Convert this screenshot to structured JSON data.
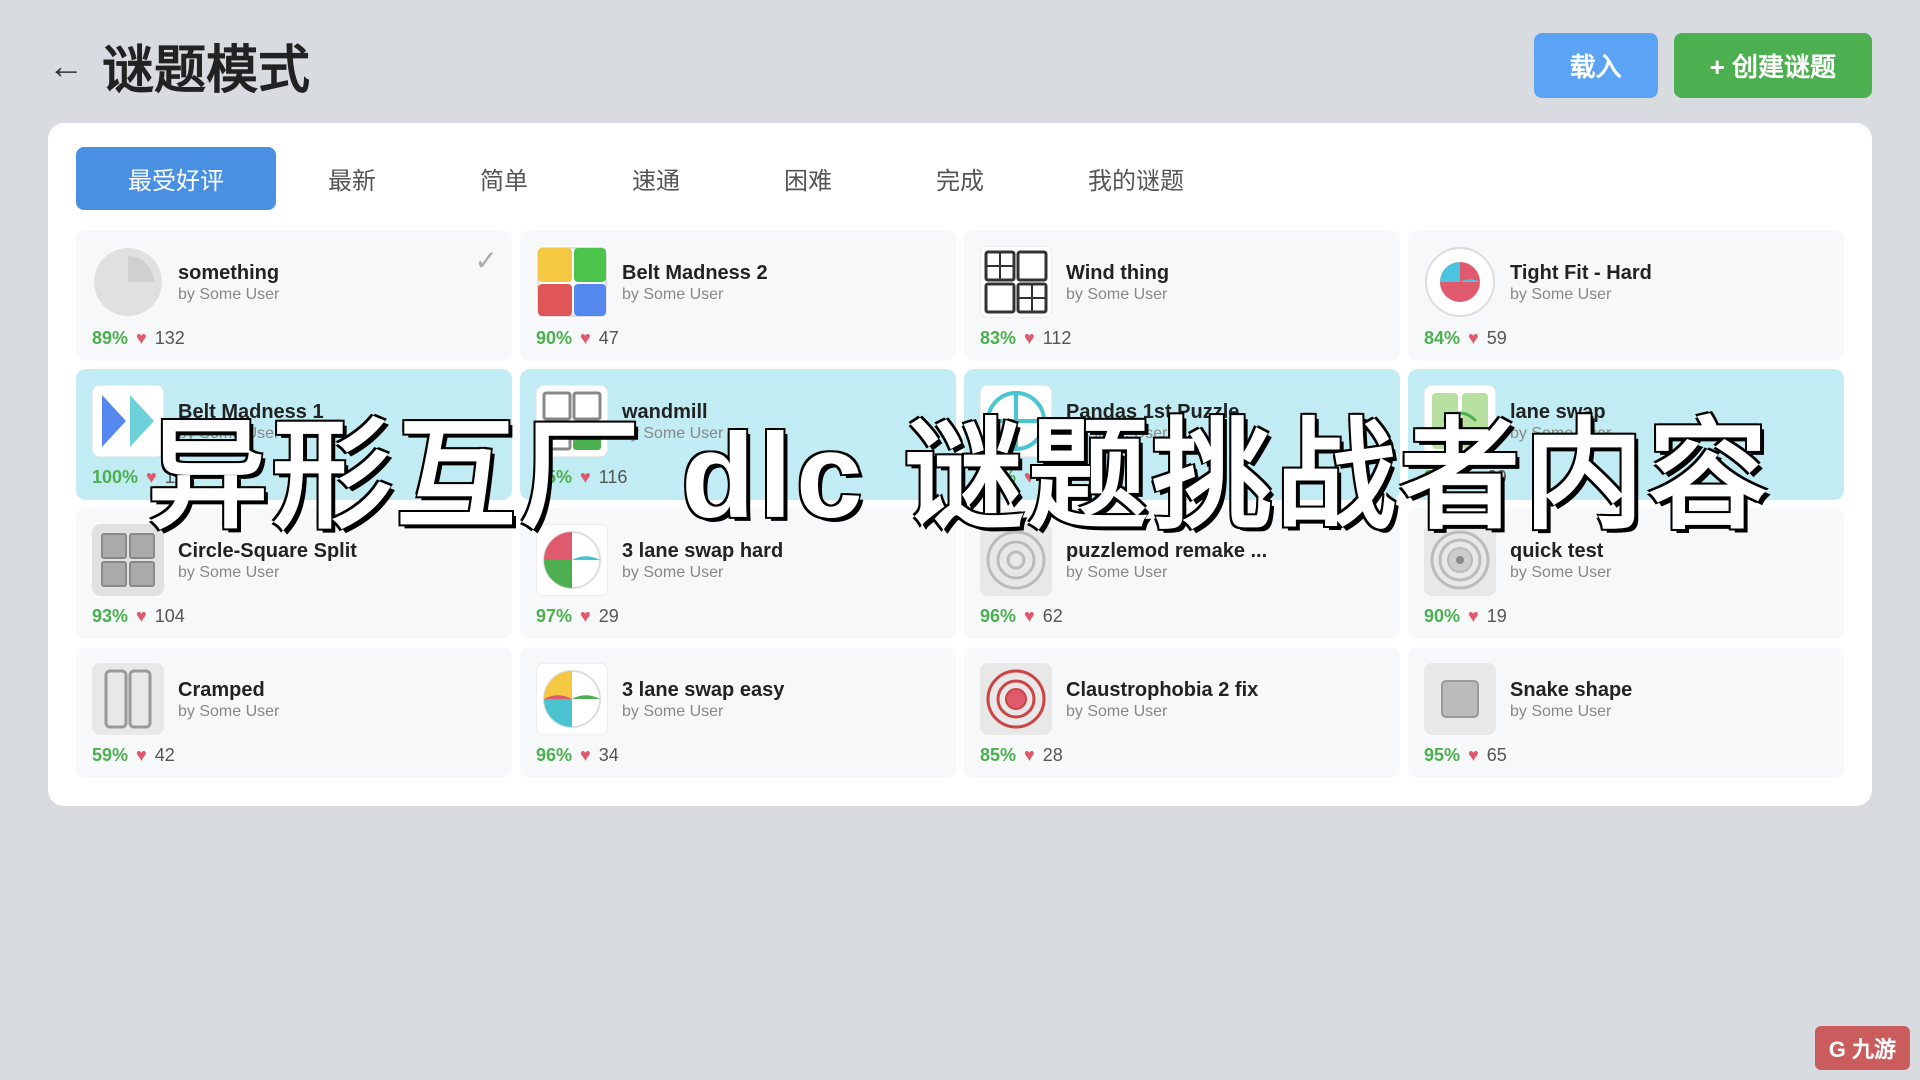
{
  "header": {
    "back_label": "←",
    "title": "谜题模式",
    "btn_load": "载入",
    "btn_create": "+ 创建谜题"
  },
  "tabs": [
    {
      "label": "最受好评",
      "active": true
    },
    {
      "label": "最新",
      "active": false
    },
    {
      "label": "简单",
      "active": false
    },
    {
      "label": "速通",
      "active": false
    },
    {
      "label": "困难",
      "active": false
    },
    {
      "label": "完成",
      "active": false
    },
    {
      "label": "我的谜题",
      "active": false
    }
  ],
  "overlay_text": "异形互厂 dlc 谜题挑战者内容",
  "watermark": "G 九游",
  "rows": [
    {
      "cards": [
        {
          "name": "something",
          "author": "by Some User",
          "rating": "89%",
          "likes": "132",
          "has_check": true,
          "icon_type": "something"
        },
        {
          "name": "Belt Madness 2",
          "author": "by Some User",
          "rating": "90%",
          "likes": "47",
          "has_check": false,
          "icon_type": "belt2"
        },
        {
          "name": "Wind thing",
          "author": "by Some User",
          "rating": "83%",
          "likes": "112",
          "has_check": false,
          "icon_type": "wind"
        },
        {
          "name": "Tight Fit - Hard",
          "author": "by Some User",
          "rating": "84%",
          "likes": "59",
          "has_check": false,
          "icon_type": "tightfit"
        }
      ]
    },
    {
      "highlight": true,
      "cards": [
        {
          "name": "Belt Madness 1",
          "author": "by Some User",
          "rating": "100%",
          "likes": "11",
          "has_check": false,
          "icon_type": "belt1"
        },
        {
          "name": "wandmill",
          "author": "by Some User",
          "rating": "95%",
          "likes": "116",
          "has_check": false,
          "icon_type": "wandmill"
        },
        {
          "name": "Pandas 1st Puzzle",
          "author": "by Some User",
          "rating": "96%",
          "likes": "133",
          "has_check": false,
          "icon_type": "pandas"
        },
        {
          "name": "lane swap",
          "author": "by Some User",
          "rating": "89%",
          "likes": "69",
          "has_check": false,
          "icon_type": "laneswap"
        }
      ]
    },
    {
      "cards": [
        {
          "name": "Circle-Square Split",
          "author": "by Some User",
          "rating": "93%",
          "likes": "104",
          "has_check": false,
          "icon_type": "circlesquare"
        },
        {
          "name": "3 lane swap hard",
          "author": "by Some User",
          "rating": "97%",
          "likes": "29",
          "has_check": false,
          "icon_type": "laneswaphard"
        },
        {
          "name": "puzzlemod remake ...",
          "author": "by Some User",
          "rating": "96%",
          "likes": "62",
          "has_check": false,
          "icon_type": "puzzlemod"
        },
        {
          "name": "quick test",
          "author": "by Some User",
          "rating": "90%",
          "likes": "19",
          "has_check": false,
          "icon_type": "quicktest"
        }
      ]
    },
    {
      "cards": [
        {
          "name": "Cramped",
          "author": "by Some User",
          "rating": "59%",
          "likes": "42",
          "has_check": false,
          "icon_type": "cramped"
        },
        {
          "name": "3 lane swap easy",
          "author": "by Some User",
          "rating": "96%",
          "likes": "34",
          "has_check": false,
          "icon_type": "laneswapeasy"
        },
        {
          "name": "Claustrophobia 2 fix",
          "author": "by Some User",
          "rating": "85%",
          "likes": "28",
          "has_check": false,
          "icon_type": "claustro"
        },
        {
          "name": "Snake shape",
          "author": "by Some User",
          "rating": "95%",
          "likes": "65",
          "has_check": false,
          "icon_type": "snakeshape"
        }
      ]
    }
  ]
}
